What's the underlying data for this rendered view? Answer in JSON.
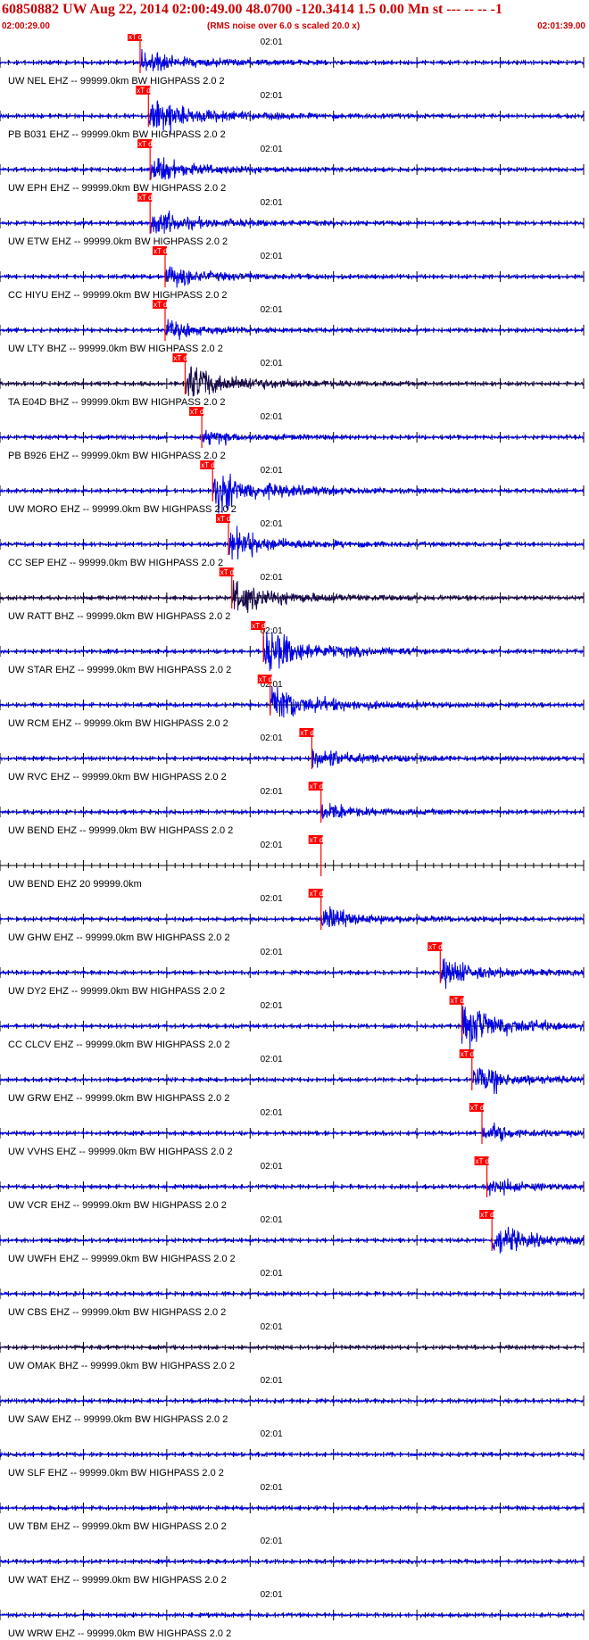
{
  "header": {
    "title": "60850882 UW Aug 22, 2014 02:00:49.00    48.0700 -120.3414  1.5 0.00 Mn st --- -- --   -1",
    "start_time": "02:00:29.00",
    "noise_note": "(RMS noise over 6.0 s scaled 20.0 x)",
    "end_time": "02:01:39.00"
  },
  "chart_data": {
    "type": "line",
    "time_range_s": [
      0,
      70
    ],
    "minute_mark_label": "02:01",
    "minute_mark_s": 31,
    "pick_label": "xT d",
    "colors": {
      "trace_blue": "#0000e6",
      "trace_dark": "#1a0a4a",
      "pick": "#ff0000",
      "axis": "#000000"
    },
    "traces": [
      {
        "label": "UW NEL EHZ -- 99999.0km BW  HIGHPASS  2.0  2",
        "pick_s": 16.8,
        "amp": 0.55,
        "style": "blue"
      },
      {
        "label": "PB B031 EHZ -- 99999.0km BW  HIGHPASS  2.0  2",
        "pick_s": 17.8,
        "amp": 0.9,
        "style": "blue"
      },
      {
        "label": "UW EPH EHZ -- 99999.0km BW  HIGHPASS  2.0  2",
        "pick_s": 18.0,
        "amp": 0.6,
        "style": "blue"
      },
      {
        "label": "UW ETW EHZ -- 99999.0km BW  HIGHPASS  2.0  2",
        "pick_s": 18.0,
        "amp": 0.6,
        "style": "blue"
      },
      {
        "label": "CC HIYU EHZ -- 99999.0km BW  HIGHPASS  2.0  2",
        "pick_s": 19.8,
        "amp": 0.5,
        "style": "blue"
      },
      {
        "label": "UW LTY BHZ -- 99999.0km BW  HIGHPASS  2.0  2",
        "pick_s": 19.8,
        "amp": 0.4,
        "style": "blue"
      },
      {
        "label": "TA E04D BHZ -- 99999.0km BW  HIGHPASS  2.0  2",
        "pick_s": 22.2,
        "amp": 0.9,
        "style": "dark"
      },
      {
        "label": "PB B926 EHZ -- 99999.0km BW  HIGHPASS  2.0  2",
        "pick_s": 24.2,
        "amp": 0.3,
        "style": "blue"
      },
      {
        "label": "UW MORO EHZ -- 99999.0km BW  HIGHPASS  2.0  2",
        "pick_s": 25.5,
        "amp": 1.0,
        "style": "blue"
      },
      {
        "label": "CC SEP EHZ -- 99999.0km BW  HIGHPASS  2.0  2",
        "pick_s": 27.4,
        "amp": 0.7,
        "style": "blue"
      },
      {
        "label": "UW RATT BHZ -- 99999.0km BW  HIGHPASS  2.0  2",
        "pick_s": 27.8,
        "amp": 0.8,
        "style": "dark"
      },
      {
        "label": "UW STAR EHZ -- 99999.0km BW  HIGHPASS  2.0  2",
        "pick_s": 31.6,
        "amp": 1.0,
        "style": "blue"
      },
      {
        "label": "UW RCM EHZ -- 99999.0km BW  HIGHPASS  2.0  2",
        "pick_s": 32.4,
        "amp": 0.9,
        "style": "blue"
      },
      {
        "label": "UW RVC EHZ -- 99999.0km BW  HIGHPASS  2.0  2",
        "pick_s": 37.4,
        "amp": 0.5,
        "style": "blue"
      },
      {
        "label": "UW BEND EHZ -- 99999.0km BW  HIGHPASS  2.0  2",
        "pick_s": 38.5,
        "amp": 0.4,
        "style": "blue"
      },
      {
        "label": "UW BEND EHZ 20 99999.0km",
        "pick_s": 38.5,
        "amp": 0.0,
        "style": "none"
      },
      {
        "label": "UW GHW EHZ -- 99999.0km BW  HIGHPASS  2.0  2",
        "pick_s": 38.5,
        "amp": 0.5,
        "style": "blue"
      },
      {
        "label": "UW DY2 EHZ -- 99999.0km BW  HIGHPASS  2.0  2",
        "pick_s": 52.8,
        "amp": 0.6,
        "style": "blue"
      },
      {
        "label": "CC CLCV EHZ -- 99999.0km BW  HIGHPASS  2.0  2",
        "pick_s": 55.4,
        "amp": 1.0,
        "style": "blue"
      },
      {
        "label": "UW GRW EHZ -- 99999.0km BW  HIGHPASS  2.0  2",
        "pick_s": 56.6,
        "amp": 0.6,
        "style": "blue"
      },
      {
        "label": "UW VVHS EHZ -- 99999.0km BW  HIGHPASS  2.0  2",
        "pick_s": 57.8,
        "amp": 0.4,
        "style": "blue"
      },
      {
        "label": "UW VCR EHZ -- 99999.0km BW  HIGHPASS  2.0  2",
        "pick_s": 58.4,
        "amp": 0.35,
        "style": "blue"
      },
      {
        "label": "UW UWFH EHZ -- 99999.0km BW  HIGHPASS  2.0  2",
        "pick_s": 59.0,
        "amp": 0.7,
        "style": "blue"
      },
      {
        "label": "UW CBS EHZ -- 99999.0km BW  HIGHPASS  2.0  2",
        "pick_s": null,
        "amp": 0.4,
        "style": "blue"
      },
      {
        "label": "UW OMAK BHZ -- 99999.0km BW  HIGHPASS  2.0  2",
        "pick_s": null,
        "amp": 0.3,
        "style": "dark"
      },
      {
        "label": "UW SAW EHZ -- 99999.0km BW  HIGHPASS  2.0  2",
        "pick_s": null,
        "amp": 0.35,
        "style": "blue"
      },
      {
        "label": "UW SLF EHZ -- 99999.0km BW  HIGHPASS  2.0  2",
        "pick_s": null,
        "amp": 0.4,
        "style": "blue"
      },
      {
        "label": "UW TBM EHZ -- 99999.0km BW  HIGHPASS  2.0  2",
        "pick_s": null,
        "amp": 0.3,
        "style": "blue"
      },
      {
        "label": "UW WAT EHZ -- 99999.0km BW  HIGHPASS  2.0  2",
        "pick_s": null,
        "amp": 0.25,
        "style": "blue"
      },
      {
        "label": "UW WRW EHZ -- 99999.0km BW  HIGHPASS  2.0  2",
        "pick_s": null,
        "amp": 0.3,
        "style": "blue"
      }
    ]
  }
}
